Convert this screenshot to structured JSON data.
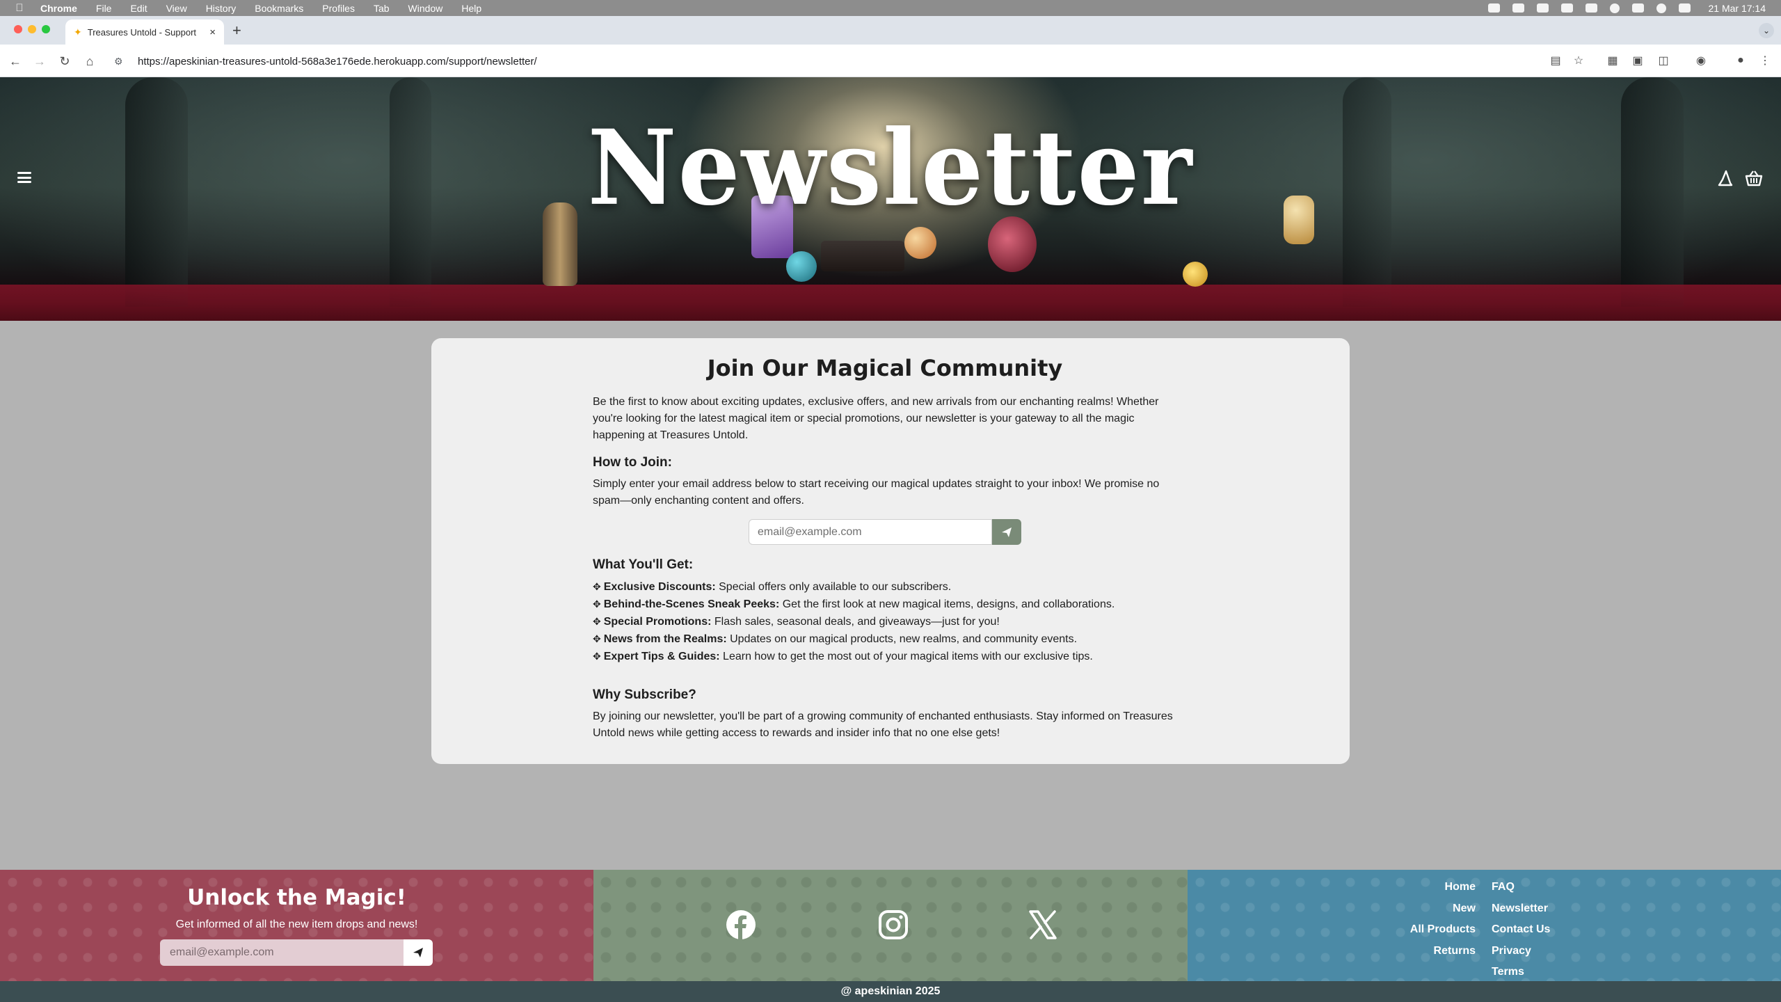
{
  "os_menubar": {
    "app": "Chrome",
    "items": [
      "File",
      "Edit",
      "View",
      "History",
      "Bookmarks",
      "Profiles",
      "Tab",
      "Window",
      "Help"
    ],
    "clock": "21 Mar  17:14"
  },
  "browser": {
    "tab_title": "Treasures Untold - Support",
    "url": "https://apeskinian-treasures-untold-568a3e176ede.herokuapp.com/support/newsletter/"
  },
  "header": {
    "title": "Newsletter",
    "icons": [
      "menu-icon",
      "wizard-hat-icon",
      "basket-icon"
    ]
  },
  "main": {
    "title": "Join Our Magical Community",
    "intro": "Be the first to know about exciting updates, exclusive offers, and new arrivals from our enchanting realms! Whether you're looking for the latest magical item or special promotions, our newsletter is your gateway to all the magic happening at Treasures Untold.",
    "how_heading": "How to Join:",
    "how_text": "Simply enter your email address below to start receiving our magical updates straight to your inbox! We promise no spam—only enchanting content and offers.",
    "email_placeholder": "email@example.com",
    "get_heading": "What You'll Get:",
    "benefits": [
      {
        "title": "Exclusive Discounts:",
        "text": " Special offers only available to our subscribers."
      },
      {
        "title": "Behind-the-Scenes Sneak Peeks:",
        "text": " Get the first look at new magical items, designs, and collaborations."
      },
      {
        "title": "Special Promotions:",
        "text": " Flash sales, seasonal deals, and giveaways—just for you!"
      },
      {
        "title": "News from the Realms:",
        "text": " Updates on our magical products, new realms, and community events."
      },
      {
        "title": "Expert Tips & Guides:",
        "text": " Learn how to get the most out of your magical items with our exclusive tips."
      }
    ],
    "why_heading": "Why Subscribe?",
    "why_text": "By joining our newsletter, you'll be part of a growing community of enchanted enthusiasts. Stay informed on Treasures Untold news while getting access to rewards and insider info that no one else gets!"
  },
  "footer": {
    "unlock_title": "Unlock the Magic!",
    "unlock_sub": "Get informed of all the new item drops and news!",
    "email_placeholder": "email@example.com",
    "social": [
      "facebook-icon",
      "instagram-icon",
      "x-icon"
    ],
    "links_left": [
      "Home",
      "New",
      "All Products",
      "Returns"
    ],
    "links_right": [
      "FAQ",
      "Newsletter",
      "Contact Us",
      "Privacy",
      "Terms"
    ],
    "copyright": "@ apeskinian 2025"
  },
  "colors": {
    "footer_newsletter": "#9c4757",
    "footer_social": "#7f957d",
    "footer_links": "#4b8aa6",
    "copyright_bar": "#3b4e52",
    "submit_button": "#7a8b78"
  }
}
